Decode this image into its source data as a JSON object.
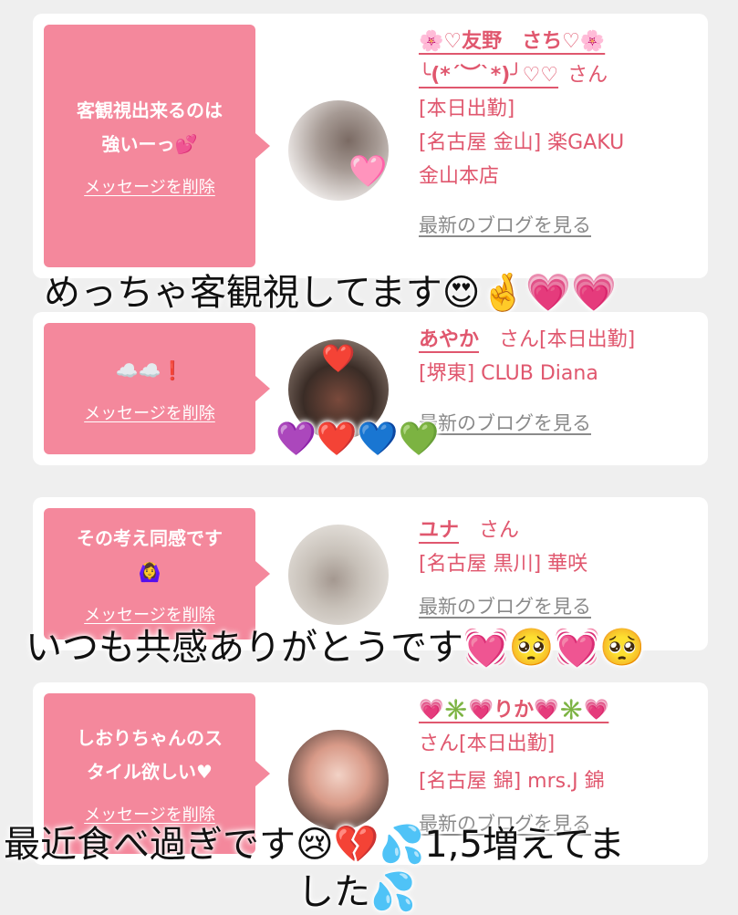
{
  "cards": [
    {
      "bubble": "客観視出来るのは\n強いーっ💕",
      "delete": "メッセージを削除",
      "name": "🌸♡友野　さち♡🌸\n╰(*´︶`*)╯♡♡",
      "san": "さん",
      "lines": [
        "[本日出勤]",
        "[名古屋 金山] 楽GAKU",
        "金山本店"
      ],
      "blog": "最新のブログを見る",
      "avatar_emoji": "🩷"
    },
    {
      "bubble": "☁️☁️❗️",
      "delete": "メッセージを削除",
      "name": "あやか",
      "san": "さん[本日出勤]",
      "lines": [
        "[堺東] CLUB Diana"
      ],
      "blog": "最新のブログを見る",
      "avatar_emoji": "❤️"
    },
    {
      "bubble": "その考え同感です\n🙆‍♀️",
      "delete": "メッセージを削除",
      "name": "ユナ",
      "san": "さん",
      "lines": [
        "[名古屋 黒川] 華咲"
      ],
      "blog": "最新のブログを見る",
      "avatar_emoji": ""
    },
    {
      "bubble": "しおりちゃんのス\nタイル欲しい♥",
      "delete": "メッセージを削除",
      "name": "💗✳️💗りか💗✳️💗",
      "san": "",
      "lines": [
        "さん[本日出勤]",
        "[名古屋 錦] mrs.J 錦"
      ],
      "blog": "最新のブログを見る",
      "avatar_emoji": ""
    }
  ],
  "overlays": {
    "caption1": "めっちゃ客観視してます😍🤞💗💗",
    "hearts": "💜❤️💙💚",
    "caption3": "いつも共感ありがとうです💓🥺💓🥺",
    "caption4a": "最近食べ過ぎです😢💔💦1,5増えてま",
    "caption4b": "した💦"
  },
  "colors": {
    "pink_bubble": "#f4889c",
    "pink_text": "#e0576e",
    "gray_link": "#8a8a8a",
    "background": "#efefef"
  }
}
